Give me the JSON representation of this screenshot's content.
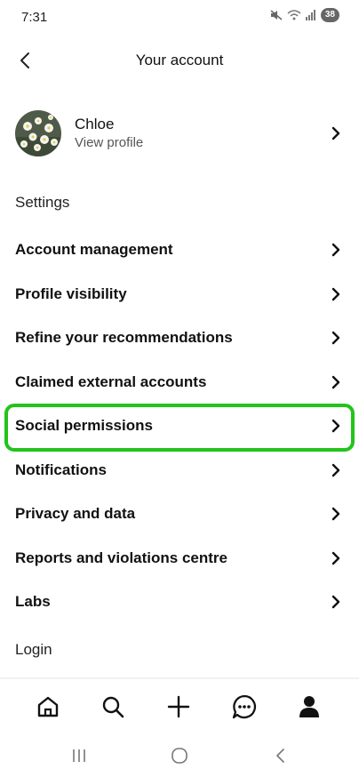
{
  "status_bar": {
    "time": "7:31",
    "battery": "38"
  },
  "header": {
    "title": "Your account"
  },
  "profile": {
    "name": "Chloe",
    "subtitle": "View profile"
  },
  "settings_label": "Settings",
  "menu": {
    "items": [
      {
        "label": "Account management"
      },
      {
        "label": "Profile visibility"
      },
      {
        "label": "Refine your recommendations"
      },
      {
        "label": "Claimed external accounts"
      },
      {
        "label": "Social permissions"
      },
      {
        "label": "Notifications"
      },
      {
        "label": "Privacy and data"
      },
      {
        "label": "Reports and violations centre"
      },
      {
        "label": "Labs"
      }
    ],
    "highlighted_item": "Social permissions",
    "highlight_color": "#22c41b"
  },
  "login_label": "Login",
  "bottom_nav": {
    "items": [
      "home-icon",
      "search-icon",
      "plus-icon",
      "messages-icon",
      "profile-icon"
    ],
    "active": "profile-icon"
  },
  "system_nav": [
    "recents-icon",
    "home-circle-icon",
    "back-icon"
  ]
}
